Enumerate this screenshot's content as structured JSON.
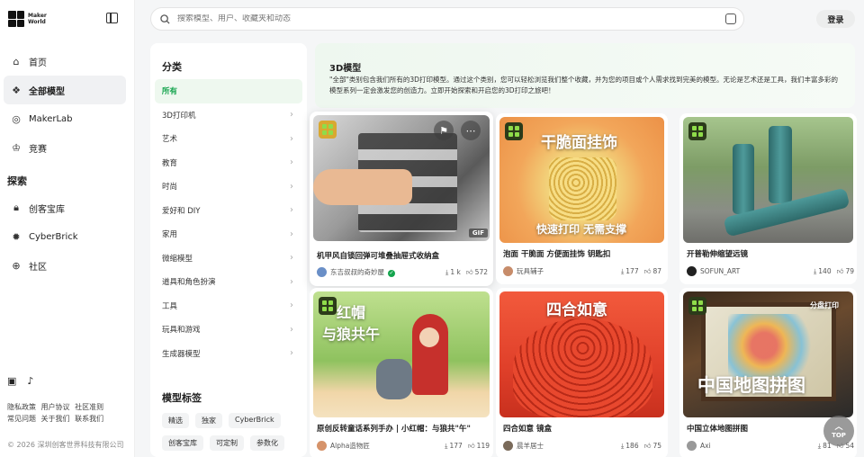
{
  "brand": {
    "line1": "Maker",
    "line2": "World"
  },
  "nav": [
    {
      "label": "首页",
      "icon": "home-icon"
    },
    {
      "label": "全部模型",
      "icon": "cubes-icon",
      "active": true
    },
    {
      "label": "MakerLab",
      "icon": "makerlab-icon"
    },
    {
      "label": "竞赛",
      "icon": "trophy-icon"
    }
  ],
  "explore": {
    "title": "探索",
    "items": [
      {
        "label": "创客宝库",
        "icon": "lock-icon"
      },
      {
        "label": "CyberBrick",
        "icon": "cyberbrick-icon"
      },
      {
        "label": "社区",
        "icon": "globe-icon"
      }
    ]
  },
  "footer": {
    "links": [
      "隐私政策",
      "用户协议",
      "社区准则",
      "常见问题",
      "关于我们",
      "联系我们"
    ],
    "copyright": "© 2026 深圳创客世界科技有限公司"
  },
  "search": {
    "placeholder": "搜索模型、用户、收藏夹和动态"
  },
  "login": "登录",
  "categories": {
    "title": "分类",
    "items": [
      "所有",
      "3D打印机",
      "艺术",
      "教育",
      "时尚",
      "爱好和 DIY",
      "家用",
      "微缩模型",
      "道具和角色扮演",
      "工具",
      "玩具和游戏",
      "生成器模型"
    ]
  },
  "model_tags": {
    "title": "模型标签",
    "items": [
      "精选",
      "独家",
      "CyberBrick",
      "创客宝库",
      "可定制",
      "参数化"
    ]
  },
  "header": {
    "title": "3D模型",
    "description": "\"全部\"类别包含我们所有的3D打印模型。通过这个类别，您可以轻松浏览我们整个收藏，并为您的项目或个人需求找到完美的模型。无论是艺术还是工具，我们丰富多彩的模型系列一定会激发您的创造力。立即开始探索和开启您的3D打印之旅吧！"
  },
  "cards": [
    {
      "title": "机甲风自锁回弹可堆叠抽屉式收纳盒",
      "author": "东吉叔叔的奇妙屋",
      "downloads": "1 k",
      "likes": "572",
      "verified": true,
      "gif": "GIF"
    },
    {
      "title": "泡面 干脆面 方便面挂饰 钥匙扣",
      "author": "玩具辅子",
      "downloads": "177",
      "likes": "87",
      "img_text1": "干脆面挂饰",
      "img_text2": "快速打印 无需支撑"
    },
    {
      "title": "开普勒伸缩望远镜",
      "author": "SOFUN_ART",
      "downloads": "140",
      "likes": "79"
    },
    {
      "title": "原创反转童话系列手办 | 小红帽：与狼共\"午\"",
      "author": "Alpha造物匠",
      "downloads": "177",
      "likes": "119",
      "img_text1": "红帽",
      "img_text2": "与狼共午"
    },
    {
      "title": "四合如意 镜盒",
      "author": "晨羊居士",
      "downloads": "186",
      "likes": "75",
      "img_text1": "四合如意"
    },
    {
      "title": "中国立体地图拼图",
      "author": "Axi",
      "downloads": "81",
      "likes": "54",
      "img_text1": "中国地图拼图",
      "img_text2": "分盘打印"
    }
  ],
  "top_label": "TOP"
}
